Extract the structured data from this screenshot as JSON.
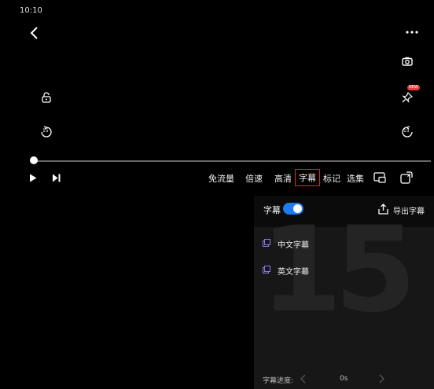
{
  "status_bar": {
    "time": "10:10"
  },
  "player": {
    "controls": {
      "data_saver": "免流量",
      "speed": "倍速",
      "quality": "高清",
      "subtitle": "字幕",
      "mark": "标记",
      "episodes": "选集"
    },
    "progress": 0.0,
    "new_badge": "NEW",
    "rewind_badge": "15",
    "forward_badge": "15"
  },
  "subtitle_panel": {
    "title": "字幕",
    "enabled": true,
    "export_label": "导出字幕",
    "options": [
      {
        "label": "中文字幕"
      },
      {
        "label": "英文字幕"
      }
    ],
    "progress_label": "字幕进度:",
    "progress_value": "0s",
    "decor_text": "15"
  },
  "colors": {
    "accent": "#1e7bf0",
    "highlight_border": "#e0281e",
    "badge": "#e8403a"
  }
}
